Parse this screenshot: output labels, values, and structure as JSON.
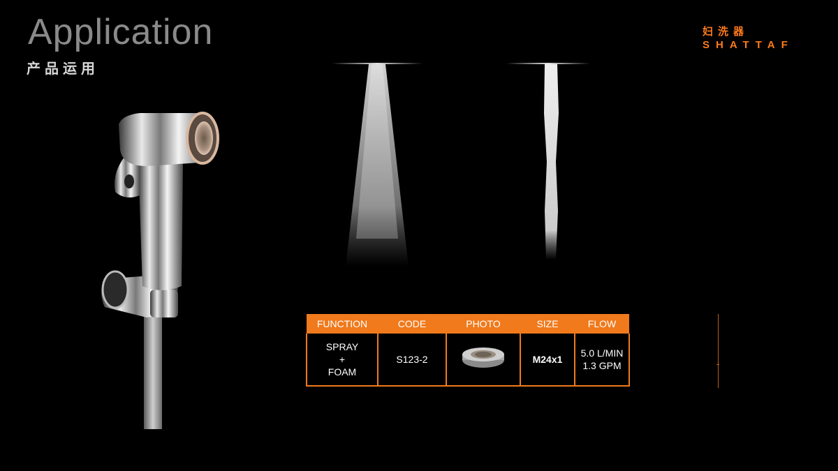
{
  "header": {
    "title": "Application",
    "subtitle_cn": "产品运用"
  },
  "brand": {
    "name_cn": "妇洗器",
    "name_en": "SHATTAF",
    "color": "#ff7a1a"
  },
  "table": {
    "accent_color": "#f07a1c",
    "headers": [
      "FUNCTION",
      "CODE",
      "PHOTO",
      "SIZE",
      "FLOW"
    ],
    "row": {
      "function_line1": "SPRAY",
      "function_line2": "+",
      "function_line3": "FOAM",
      "code": "S123-2",
      "photo": "aerator-insert-image",
      "size": "M24x1",
      "flow_line1": "5.0 L/MIN",
      "flow_line2": "1.3 GPM"
    }
  },
  "images": {
    "product": "chrome-shattaf-sprayer-with-holder",
    "spray": "spray-pattern-water",
    "stream": "foam-stream-water"
  }
}
